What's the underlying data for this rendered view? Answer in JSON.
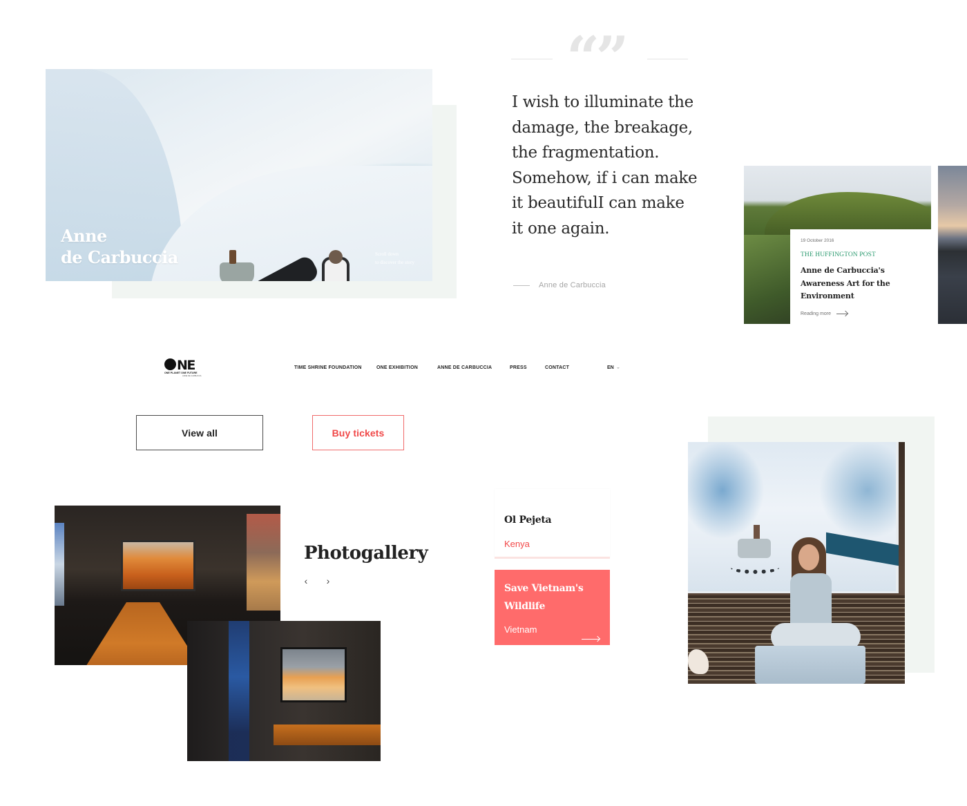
{
  "hero": {
    "title_line1": "Anne",
    "title_line2": "de Carbuccia",
    "scroll_line1": "Scroll down",
    "scroll_line2": "to discover the story"
  },
  "quote": {
    "mark": "“”",
    "text": "I wish to illuminate the damage, the breakage, the fragmentation. Somehow, if i can make it beautifulI can make it one again.",
    "author": "Anne de Carbuccia"
  },
  "press": {
    "date": "19 October 2016",
    "source": "THE HUFFINGTON POST",
    "title": "Anne de Carbuccia's Awareness Art for the Environment",
    "more_label": "Reading more"
  },
  "nav": {
    "logo_word": "NE",
    "logo_tagline": "ONE PLANET ONE FUTURE",
    "logo_sub": "ANNE DE CARBUCCIA",
    "items": [
      {
        "label": "TIME SHRINE FOUNDATION"
      },
      {
        "label": "ONE EXHIBITION"
      },
      {
        "label": "ANNE DE CARBUCCIA"
      },
      {
        "label": "PRESS"
      },
      {
        "label": "CONTACT"
      }
    ],
    "language": "EN"
  },
  "buttons": {
    "view_all": "View all",
    "buy_tickets": "Buy tickets"
  },
  "gallery": {
    "title": "Photogallery",
    "prev_icon": "‹",
    "next_icon": "›"
  },
  "projects": [
    {
      "title": "Ol Pejeta",
      "country": "Kenya"
    },
    {
      "title": "Save Vietnam's Wildlife",
      "country": "Vietnam"
    }
  ],
  "colors": {
    "accent_red": "#ff6b6b",
    "link_red": "#f04848",
    "press_green": "#2b9a6f",
    "panel_mint": "#f1f5f2"
  }
}
